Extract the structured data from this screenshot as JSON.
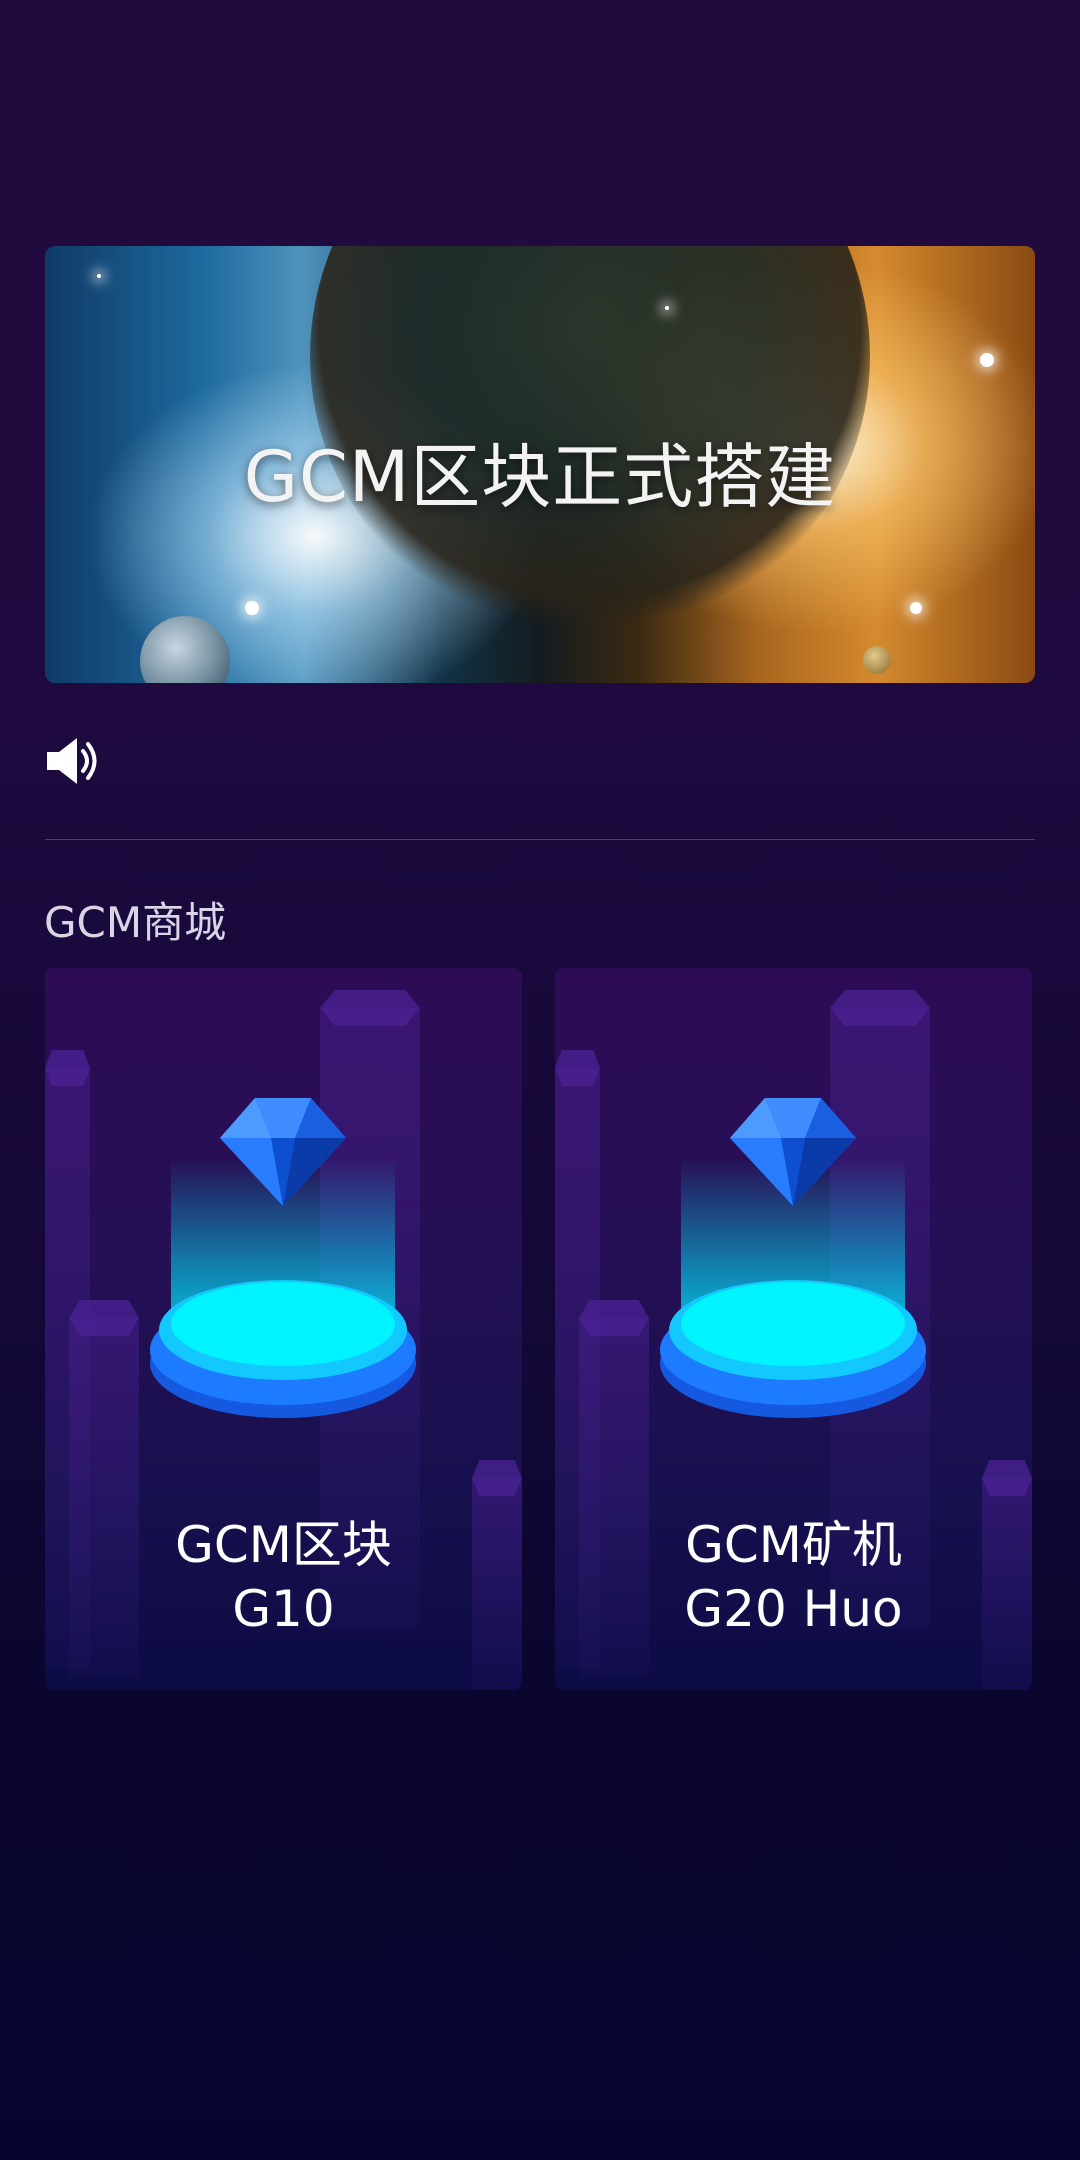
{
  "banner": {
    "title": "GCM区块正式搭建"
  },
  "notice": {
    "icon": "speaker-icon"
  },
  "section": {
    "title": "GCM商城"
  },
  "products": [
    {
      "line1": "GCM区块",
      "line2": "G10",
      "icon": "diamond-icon"
    },
    {
      "line1": "GCM矿机",
      "line2": "G20 Huo",
      "icon": "diamond-icon"
    }
  ],
  "colors": {
    "background": "#1e0a3f",
    "accent": "#00f0ff",
    "diamond": "#1f6fff"
  }
}
